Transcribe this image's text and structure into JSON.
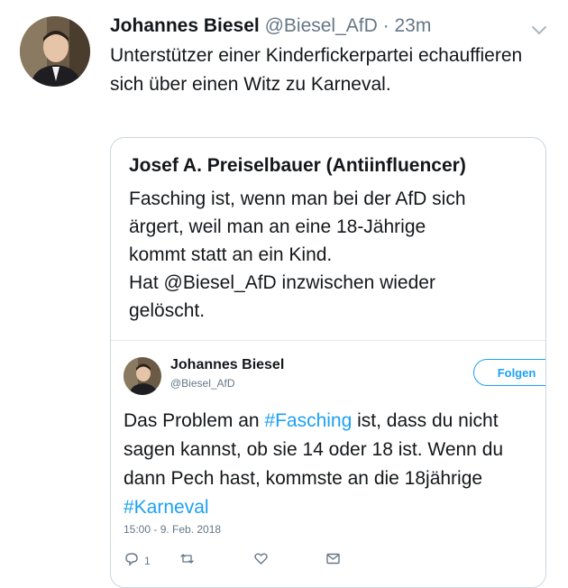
{
  "tweet": {
    "author_name": "Johannes Biesel",
    "author_handle": "@Biesel_AfD",
    "separator": "·",
    "time": "23m",
    "text": "Unterstützer einer Kinderfickerpartei echauffieren sich über einen Witz zu Karneval."
  },
  "quote": {
    "author_name": "Josef A. Preiselbauer (Antiinfluencer)",
    "text_lines": [
      "Fasching ist, wenn man bei der AfD sich",
      "ärgert, weil man an eine 18-Jährige",
      "kommt statt an ein Kind.",
      "Hat @Biesel_AfD inzwischen wieder",
      "gelöscht."
    ]
  },
  "embedded": {
    "author_name": "Johannes Biesel",
    "author_handle": "@Biesel_AfD",
    "follow_label": "Folgen",
    "line1_prefix": "Das Problem an ",
    "line1_hashtag": "#Fasching",
    "line1_suffix": " ist, dass du nicht",
    "line2": "sagen kannst, ob sie 14 oder 18 ist. Wenn du",
    "line3": "dann Pech hast, kommste an die 18jährige",
    "line4_hashtag": "#Karneval",
    "timestamp": "15:00 - 9. Feb. 2018",
    "reply_count": "1"
  },
  "colors": {
    "link": "#1da1f2",
    "muted": "#657786",
    "border": "#ccd6dd"
  },
  "icons": [
    "chevron-down-icon",
    "reply-icon",
    "retweet-icon",
    "like-icon",
    "dm-icon"
  ]
}
